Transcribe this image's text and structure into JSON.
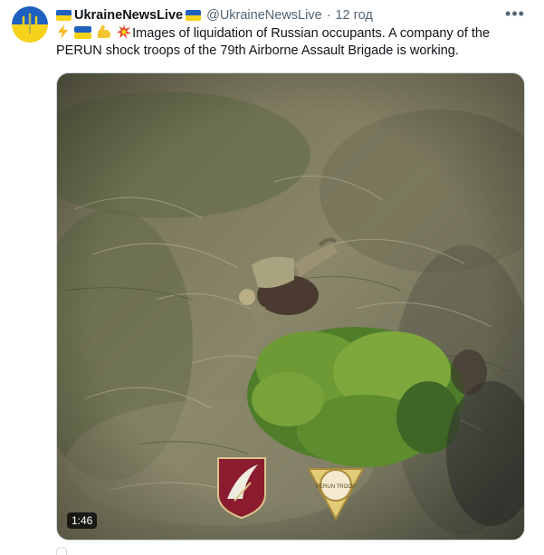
{
  "tweet": {
    "author_name": "UkraineNewsLive",
    "handle": "@UkraineNewsLive",
    "separator": "·",
    "time": "12 год",
    "more_label": "•••",
    "text": "Images of liquidation of Russian occupants. A company of the PERUN shock troops of the 79th Airborne Assault Brigade is working.",
    "emoji_icons": [
      "lightning-icon",
      "ukraine-flag-icon",
      "flexed-biceps-icon",
      "collision-icon"
    ]
  },
  "media": {
    "duration": "1:46",
    "emblem_right_text": "PERUN TROOP"
  },
  "colors": {
    "flag_blue": "#1f5fbf",
    "flag_yellow": "#f6d21b",
    "muted_text": "#536471",
    "border": "#cfd9de"
  }
}
